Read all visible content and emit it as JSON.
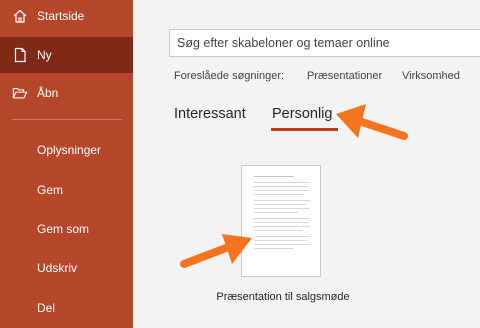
{
  "sidebar": {
    "items": [
      {
        "label": "Startside",
        "icon": "home-icon"
      },
      {
        "label": "Ny",
        "icon": "new-document-icon"
      },
      {
        "label": "Åbn",
        "icon": "folder-open-icon"
      },
      {
        "label": "Oplysninger"
      },
      {
        "label": "Gem"
      },
      {
        "label": "Gem som"
      },
      {
        "label": "Udskriv"
      },
      {
        "label": "Del"
      }
    ],
    "selected": "Ny",
    "background": "#b7472a",
    "selected_background": "#7f2a16"
  },
  "search": {
    "placeholder": "Søg efter skabeloner og temaer online"
  },
  "suggested": {
    "label": "Foreslåede søgninger:",
    "items": [
      "Præsentationer",
      "Virksomhed"
    ]
  },
  "tabs": {
    "items": [
      "Interessant",
      "Personlig"
    ],
    "active": "Personlig",
    "underline_color": "#c43e1c"
  },
  "templates": [
    {
      "name": "Præsentation til salgsmøde"
    }
  ],
  "annotation": {
    "arrow_color": "#f47420"
  }
}
